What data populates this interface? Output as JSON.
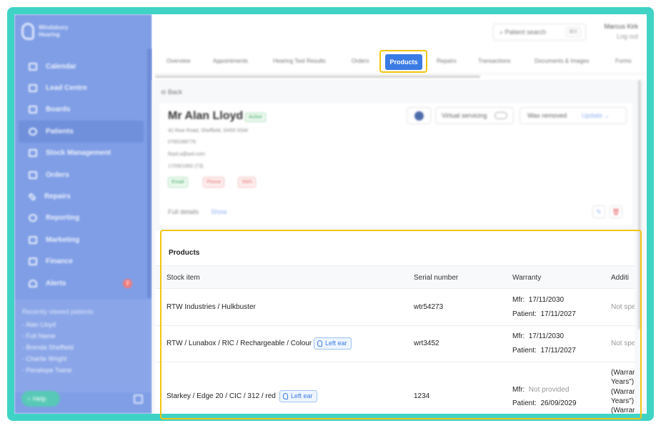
{
  "brand": {
    "name_line1": "Windsbury",
    "name_line2": "Hearing"
  },
  "sidebar": {
    "items": [
      {
        "label": "Calendar"
      },
      {
        "label": "Lead Centre"
      },
      {
        "label": "Boards"
      },
      {
        "label": "Patients"
      },
      {
        "label": "Stock Management"
      },
      {
        "label": "Orders"
      },
      {
        "label": "Repairs"
      },
      {
        "label": "Reporting"
      },
      {
        "label": "Marketing"
      },
      {
        "label": "Finance"
      },
      {
        "label": "Alerts"
      }
    ],
    "alerts_count": "7",
    "recent_title": "Recently viewed patients",
    "recent": [
      "- Alan Lloyd",
      "- Full Name",
      "- Brenda Sheffield",
      "- Charlie Wright",
      "- Penelope Twine"
    ],
    "help_label": "Help"
  },
  "topbar": {
    "search_placeholder": "Patient search",
    "search_shortcut": "⌘K",
    "user_name": "Marcus Kirk",
    "logout_label": "Log out"
  },
  "tabs": {
    "overview": "Overview",
    "appointments": "Appointments",
    "hearing_test": "Hearing Test Results",
    "orders": "Orders",
    "products": "Products",
    "repairs": "Repairs",
    "transactions": "Transactions",
    "documents": "Documents & Images",
    "forms": "Forms"
  },
  "patient": {
    "back_label": "Back",
    "name": "Mr Alan Lloyd",
    "status": "Active",
    "address": "42 Row Road, Sheffield, SH55 5SW",
    "phone": "0765288776",
    "email": "lloyd.a@aol.com",
    "dob": "17/09/1950 (73)",
    "chips": {
      "email": "Email",
      "phone": "Phone",
      "sms": "SMS"
    },
    "virtual_servicing": "Virtual servicing",
    "wax_label": "Wax removed",
    "update_label": "Update",
    "full_details": "Full details",
    "show_label": "Show"
  },
  "products": {
    "title": "Products",
    "columns": {
      "stock_item": "Stock item",
      "serial": "Serial number",
      "warranty": "Warranty",
      "additional": "Additi"
    },
    "mfr_label": "Mfr:",
    "patient_label": "Patient:",
    "rows": [
      {
        "stock_item": "RTW Industries / Hulkbuster",
        "ear": "",
        "serial": "wtr54273",
        "mfr": "17/11/2030",
        "patient": "17/11/2027",
        "additional": "Not spe"
      },
      {
        "stock_item": "RTW / Lunabox / RIC / Rechargeable / Colour",
        "ear": "Left ear",
        "serial": "wrt3452",
        "mfr": "17/11/2030",
        "patient": "17/11/2027",
        "additional": "Not spe"
      },
      {
        "stock_item": "Starkey / Edge 20 / CIC / 312 / red",
        "ear": "Left ear",
        "serial": "1234",
        "mfr": "Not provided",
        "patient": "26/09/2029",
        "additional_lines": [
          "(Warrar",
          "Years\")",
          "(Warrar",
          "Years\")",
          "(Warrar"
        ]
      }
    ]
  }
}
